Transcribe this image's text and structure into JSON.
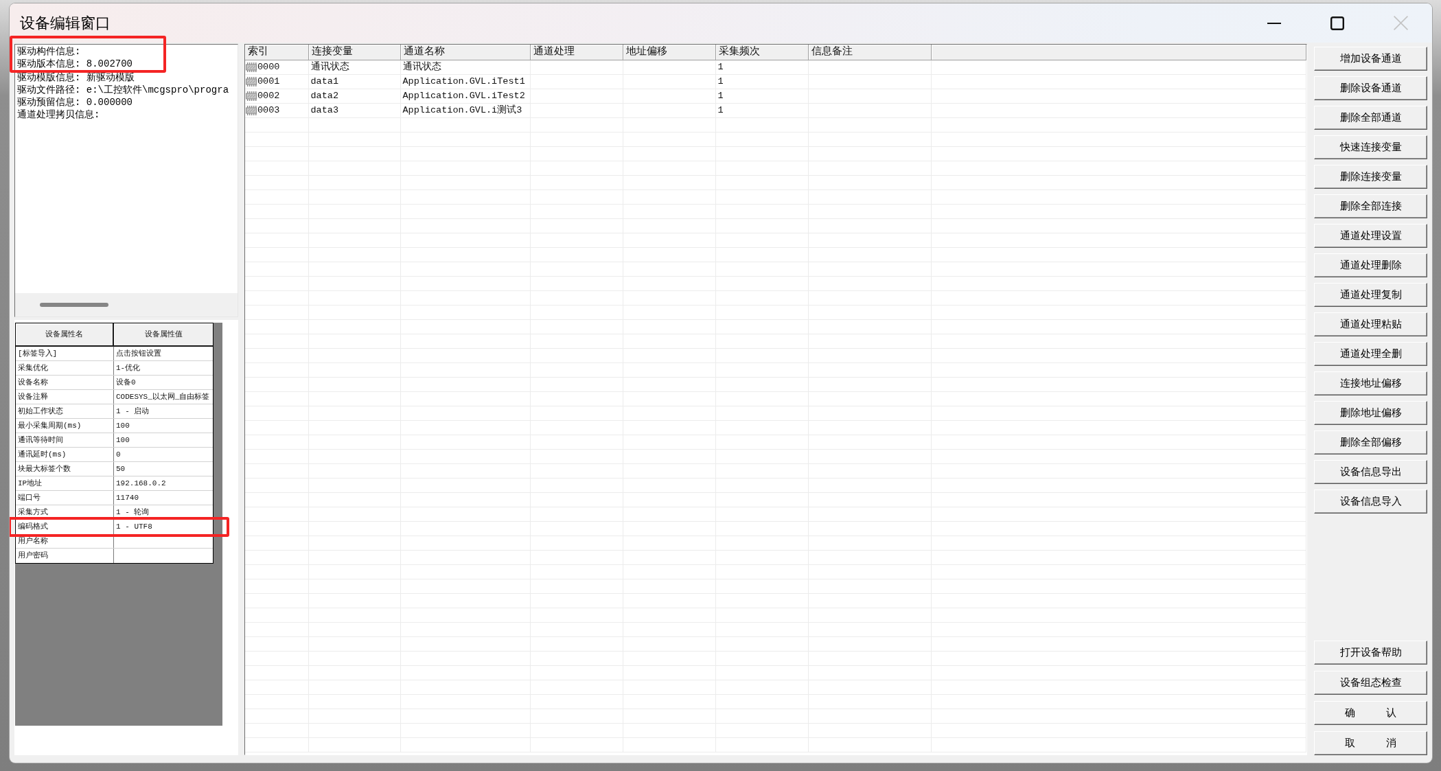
{
  "window": {
    "title": "设备编辑窗口",
    "controls": [
      {
        "kind": "minimize",
        "disabled": false
      },
      {
        "kind": "maximize",
        "disabled": false
      },
      {
        "kind": "close",
        "disabled": true
      }
    ]
  },
  "driver_info": {
    "lines": [
      {
        "text": "驱动构件信息:",
        "highlighted": true
      },
      {
        "text": "驱动版本信息: 8.002700",
        "highlighted": true
      },
      {
        "text": "驱动模版信息: 新驱动模版",
        "highlighted": false
      },
      {
        "text": "驱动文件路径: e:\\工控软件\\mcgspro\\progra",
        "highlighted": false
      },
      {
        "text": "驱动预留信息: 0.000000",
        "highlighted": false
      },
      {
        "text": "通道处理拷贝信息:",
        "highlighted": false
      }
    ]
  },
  "device_properties": {
    "columns": [
      "设备属性名",
      "设备属性值"
    ],
    "rows": [
      {
        "name": "[标签导入]",
        "value": "点击按钮设置",
        "highlighted": false
      },
      {
        "name": "采集优化",
        "value": "1-优化",
        "highlighted": false
      },
      {
        "name": "设备名称",
        "value": "设备0",
        "highlighted": false
      },
      {
        "name": "设备注释",
        "value": "CODESYS_以太网_自由标签",
        "highlighted": false
      },
      {
        "name": "初始工作状态",
        "value": "1 - 启动",
        "highlighted": false
      },
      {
        "name": "最小采集周期(ms)",
        "value": "100",
        "highlighted": false
      },
      {
        "name": "通讯等待时间",
        "value": "100",
        "highlighted": false
      },
      {
        "name": "通讯延时(ms)",
        "value": "0",
        "highlighted": false
      },
      {
        "name": "块最大标签个数",
        "value": "50",
        "highlighted": false
      },
      {
        "name": "IP地址",
        "value": "192.168.0.2",
        "highlighted": false
      },
      {
        "name": "端口号",
        "value": "11740",
        "highlighted": false
      },
      {
        "name": "采集方式",
        "value": "1 - 轮询",
        "highlighted": false
      },
      {
        "name": "编码格式",
        "value": "1 - UTF8",
        "highlighted": true
      },
      {
        "name": "用户名称",
        "highlighted": false
      },
      {
        "name": "用户密码",
        "highlighted": false
      }
    ]
  },
  "channel_table": {
    "columns": [
      "索引",
      "连接变量",
      "通道名称",
      "通道处理",
      "地址偏移",
      "采集频次",
      "信息备注"
    ],
    "rows": [
      {
        "index": "0000",
        "variable": "通讯状态",
        "channel_name": "通讯状态",
        "frequency": "1"
      },
      {
        "index": "0001",
        "variable": "data1",
        "channel_name": "Application.GVL.iTest1",
        "frequency": "1"
      },
      {
        "index": "0002",
        "variable": "data2",
        "channel_name": "Application.GVL.iTest2",
        "frequency": "1"
      },
      {
        "index": "0003",
        "variable": "data3",
        "channel_name": "Application.GVL.i测试3",
        "frequency": "1"
      }
    ]
  },
  "action_buttons": [
    "增加设备通道",
    "删除设备通道",
    "删除全部通道",
    "快速连接变量",
    "删除连接变量",
    "删除全部连接",
    "通道处理设置",
    "通道处理删除",
    "通道处理复制",
    "通道处理粘贴",
    "通道处理全删",
    "连接地址偏移",
    "删除地址偏移",
    "删除全部偏移",
    "设备信息导出",
    "设备信息导入"
  ],
  "dialog_buttons": [
    "打开设备帮助",
    "设备组态检查",
    "确　　　认",
    "取　　　消"
  ]
}
